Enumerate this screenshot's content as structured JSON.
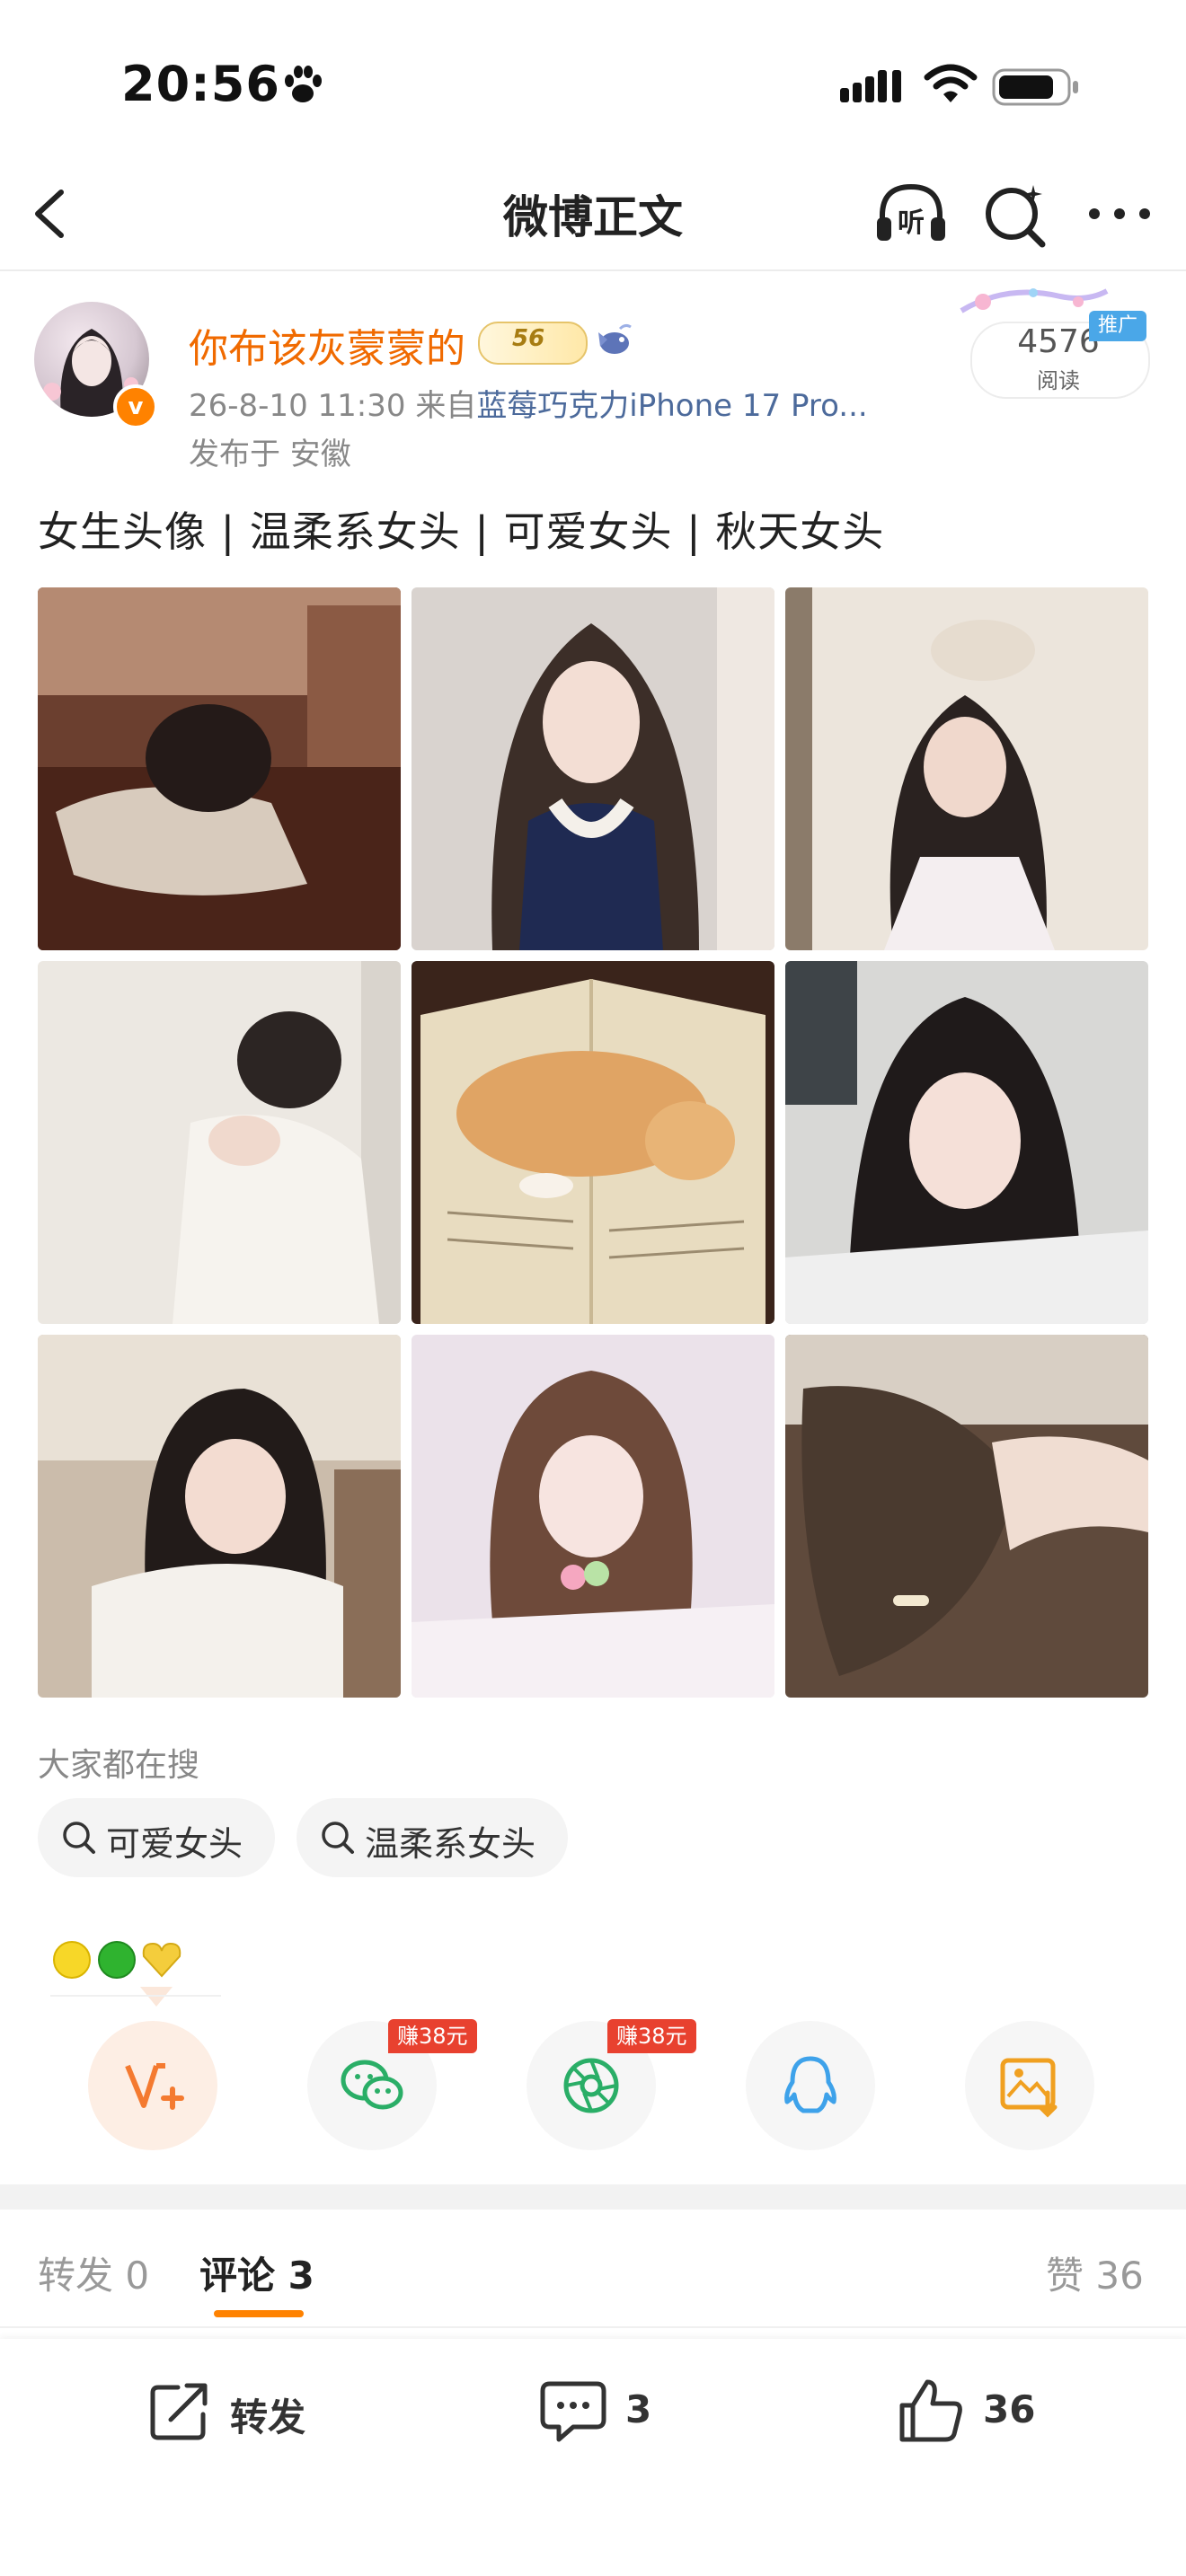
{
  "status_bar": {
    "time": "20:56"
  },
  "nav": {
    "title": "微博正文"
  },
  "author": {
    "name": "你布该灰蒙蒙的",
    "level": "56",
    "verified_mark": "v",
    "timestamp": "26-8-10 11:30",
    "source_prefix": "来自",
    "device": "蓝莓巧克力iPhone 17 Pro...",
    "location": "发布于 安徽",
    "read_count": "4576",
    "read_label": "阅读",
    "promo_tag": "推广"
  },
  "post": {
    "text": "女生头像 | 温柔系女头 | 可爱女头 | 秋天女头"
  },
  "images": [
    {
      "name": "photo-girl-asleep-sofa"
    },
    {
      "name": "photo-girl-long-hair-halter"
    },
    {
      "name": "photo-girl-kitten-on-head"
    },
    {
      "name": "photo-girl-white-sweater"
    },
    {
      "name": "photo-kitten-on-book"
    },
    {
      "name": "photo-girl-resting-chin"
    },
    {
      "name": "photo-girl-white-cardigan"
    },
    {
      "name": "photo-girl-on-bed"
    },
    {
      "name": "photo-girl-hair-on-desk"
    }
  ],
  "searches": {
    "title": "大家都在搜",
    "chips": [
      "可爱女头",
      "温柔系女头"
    ]
  },
  "emoji_row": "🟡🟢💛",
  "share": {
    "earn_wechat": "赚38元",
    "earn_moments": "赚38元"
  },
  "tabs": {
    "repost": "转发 0",
    "comment": "评论 3",
    "like": "赞 36"
  },
  "bottom_bar": {
    "repost": "转发",
    "comment_count": "3",
    "like_count": "36"
  },
  "colors": {
    "accent": "#ff8200",
    "author_name": "#f06a00",
    "earn_badge": "#e8412f",
    "wechat_green": "#2aae67",
    "qq_blue": "#3ea2ea"
  }
}
